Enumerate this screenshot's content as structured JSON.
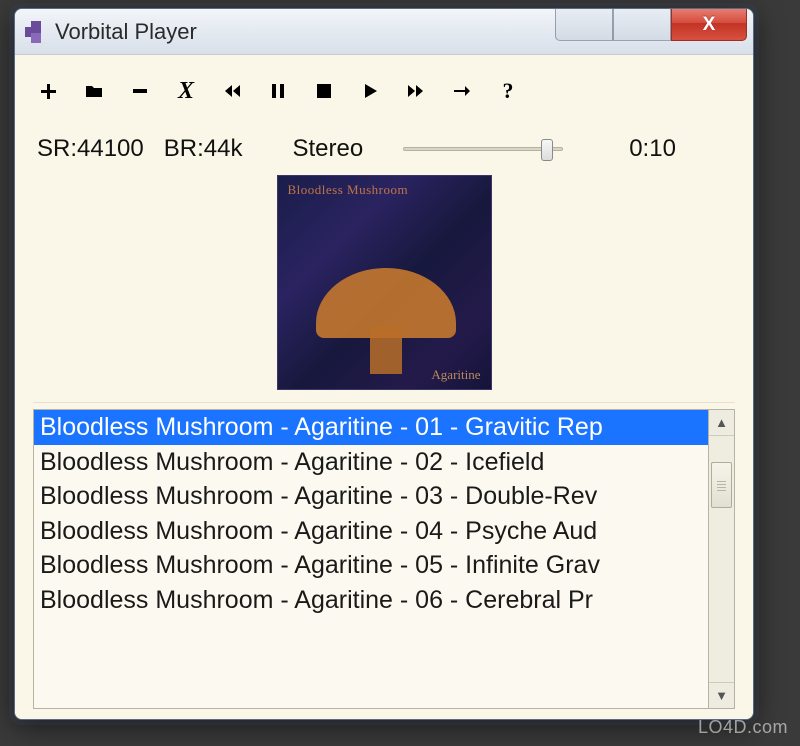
{
  "watermark": "LO4D.com",
  "window": {
    "title": "Vorbital Player"
  },
  "winbtns": {
    "min": "—",
    "max": "□",
    "close": "X"
  },
  "toolbar": {
    "add": "+",
    "folder": "folder",
    "remove": "−",
    "clear": "✗",
    "prev": "◀◀",
    "pause": "pause",
    "stop": "■",
    "play": "▶",
    "next": "▶▶",
    "repeat": "→",
    "about": "?"
  },
  "info": {
    "sr_label": "SR:",
    "sr_value": "44100",
    "br_label": "BR:",
    "br_value": "44k",
    "mode": "Stereo",
    "time": "0:10"
  },
  "album": {
    "artist": "Bloodless Mushroom",
    "title": "Agaritine"
  },
  "playlist": {
    "selected": 0,
    "items": [
      "Bloodless Mushroom - Agaritine - 01 - Gravitic Rep",
      "Bloodless Mushroom - Agaritine - 02 - Icefield",
      "Bloodless Mushroom - Agaritine - 03 - Double-Rev",
      "Bloodless Mushroom - Agaritine - 04 - Psyche Aud",
      "Bloodless Mushroom - Agaritine - 05 - Infinite Grav",
      "Bloodless Mushroom - Agaritine - 06 - Cerebral Pr"
    ]
  }
}
